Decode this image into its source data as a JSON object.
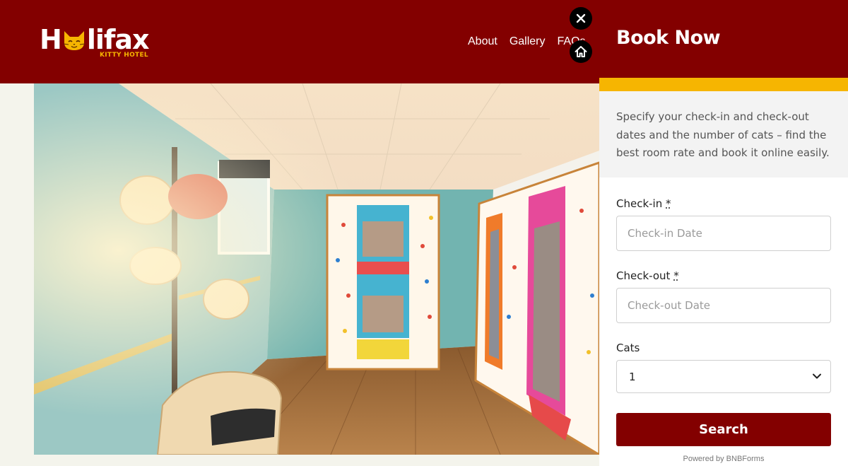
{
  "logo": {
    "wordmark_left": "H",
    "wordmark_right": "lifax",
    "subtitle": "KITTY HOTEL",
    "icon": "cat-face-icon"
  },
  "nav": {
    "items": [
      "About",
      "Gallery",
      "FAQs"
    ]
  },
  "buttons": {
    "close_icon": "close-icon",
    "home_icon": "home-icon"
  },
  "hero": {
    "description_icon": "room-photo"
  },
  "booking": {
    "title": "Book Now",
    "description": "Specify your check-in and check-out dates and the number of cats – find the best room rate and book it online easily.",
    "checkin": {
      "label": "Check-in",
      "required_mark": "*",
      "placeholder": "Check-in Date"
    },
    "checkout": {
      "label": "Check-out",
      "required_mark": "*",
      "placeholder": "Check-out Date"
    },
    "cats": {
      "label": "Cats",
      "value": "1"
    },
    "search_label": "Search",
    "powered_by": "Powered by BNBForms"
  },
  "colors": {
    "brand_red": "#830000",
    "accent_yellow": "#f6b501",
    "panel_grey": "#f3f3f3"
  }
}
